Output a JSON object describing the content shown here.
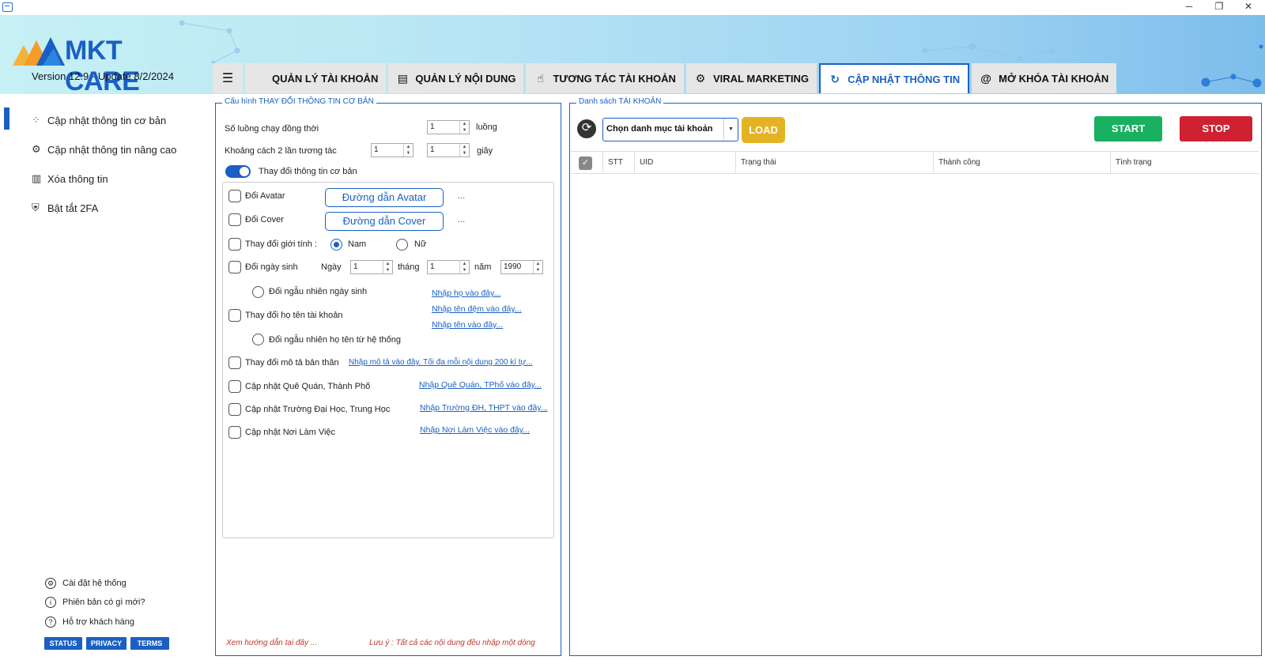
{
  "window": {
    "minimize": "─",
    "restore": "❐",
    "close": "✕"
  },
  "brand": {
    "name": "MKT CARE",
    "version": "Version  12.9 · Update  8/2/2024"
  },
  "tabs": [
    {
      "label": "QUẢN LÝ TÀI KHOẢN",
      "icon": "user-list-icon"
    },
    {
      "label": "QUẢN LÝ NỘI DUNG",
      "icon": "document-icon"
    },
    {
      "label": "TƯƠNG TÁC TÀI KHOẢN",
      "icon": "hand-tap-icon"
    },
    {
      "label": "VIRAL MARKETING",
      "icon": "grid-nodes-icon"
    },
    {
      "label": "CẬP NHẬT THÔNG TIN",
      "icon": "refresh-edit-icon",
      "active": true
    },
    {
      "label": "MỞ KHÓA TÀI KHOẢN",
      "icon": "fingerprint-icon"
    }
  ],
  "sidebar": {
    "items": [
      {
        "label": "Cập nhật thông tin cơ bản",
        "icon": "grid-icon"
      },
      {
        "label": "Cập nhật thông tin nâng cao",
        "icon": "settings-hand-icon"
      },
      {
        "label": "Xóa thông tin",
        "icon": "delete-doc-icon"
      },
      {
        "label": "Bật tắt 2FA",
        "icon": "shield-lock-icon"
      }
    ],
    "footer": [
      {
        "label": "Cài đặt hệ thống",
        "icon": "gear-icon"
      },
      {
        "label": "Phiên bản có gì mới?",
        "icon": "info-icon"
      },
      {
        "label": "Hỗ trợ khách hàng",
        "icon": "help-icon"
      }
    ],
    "badges": [
      "STATUS",
      "PRIVACY",
      "TERMS"
    ]
  },
  "config": {
    "title": "Cấu hình THAY ĐỔI THÔNG TIN CƠ BẢN",
    "threads_label": "Số luồng chạy đồng thời",
    "threads_value": "1",
    "threads_unit": "luồng",
    "interval_label": "Khoảng cách 2 lần tương tác",
    "interval_min": "1",
    "interval_max": "1",
    "interval_unit": "giây",
    "toggle_label": "Thay đổi thông tin cơ bản",
    "avatar_label": "Đổi Avatar",
    "avatar_button": "Đường dẫn Avatar",
    "cover_label": "Đổi Cover",
    "cover_button": "Đường dẫn Cover",
    "dots": "...",
    "gender_label": "Thay đổi giới tính :",
    "gender_male": "Nam",
    "gender_female": "Nữ",
    "birthday_label": "Đổi ngày sinh",
    "day_label": "Ngày",
    "day_value": "1",
    "month_label": "tháng",
    "month_value": "1",
    "year_label": "năm",
    "year_value": "1990",
    "random_birthday": "Đổi ngẫu nhiên ngày sinh",
    "fullname_label": "Thay đổi họ tên tài khoản",
    "link_lastname": "Nhập họ vào đây...",
    "link_middlename": "Nhập tên đệm vào đây...",
    "link_firstname": "Nhập tên vào đây...",
    "random_name": "Đổi ngẫu nhiên họ tên từ hệ thống",
    "bio_label": "Thay đổi mô tả bản thân",
    "link_bio": "Nhập mô tả vào đây. Tối đa mỗi nội dung 200 kí tự...",
    "hometown_label": "Cập nhật Quê Quán, Thành Phố",
    "link_hometown": "Nhập Quê Quán, TPhố vào đây...",
    "school_label": "Cập nhật Trường Đại Học, Trung Học",
    "link_school": "Nhập Trường ĐH, THPT vào đây...",
    "work_label": "Cập nhật Nơi Làm Việc",
    "link_work": "Nhập Nơi Làm Việc vào đây...",
    "guide_note": "Xem hướng dẫn tại đây ...",
    "notice_note": "Lưu ý : Tất cả các nội dung đều nhập một dòng"
  },
  "accounts": {
    "title": "Danh sách TÀI KHOẢN",
    "category_placeholder": "Chọn danh mục tài khoản",
    "load": "LOAD",
    "start": "START",
    "stop": "STOP",
    "columns": [
      "STT",
      "UID",
      "Trạng thái",
      "Thành công",
      "Tình trạng"
    ]
  },
  "colors": {
    "accent": "#1a60c4",
    "load": "#e4b323",
    "start": "#19b061",
    "stop": "#cf2131"
  }
}
